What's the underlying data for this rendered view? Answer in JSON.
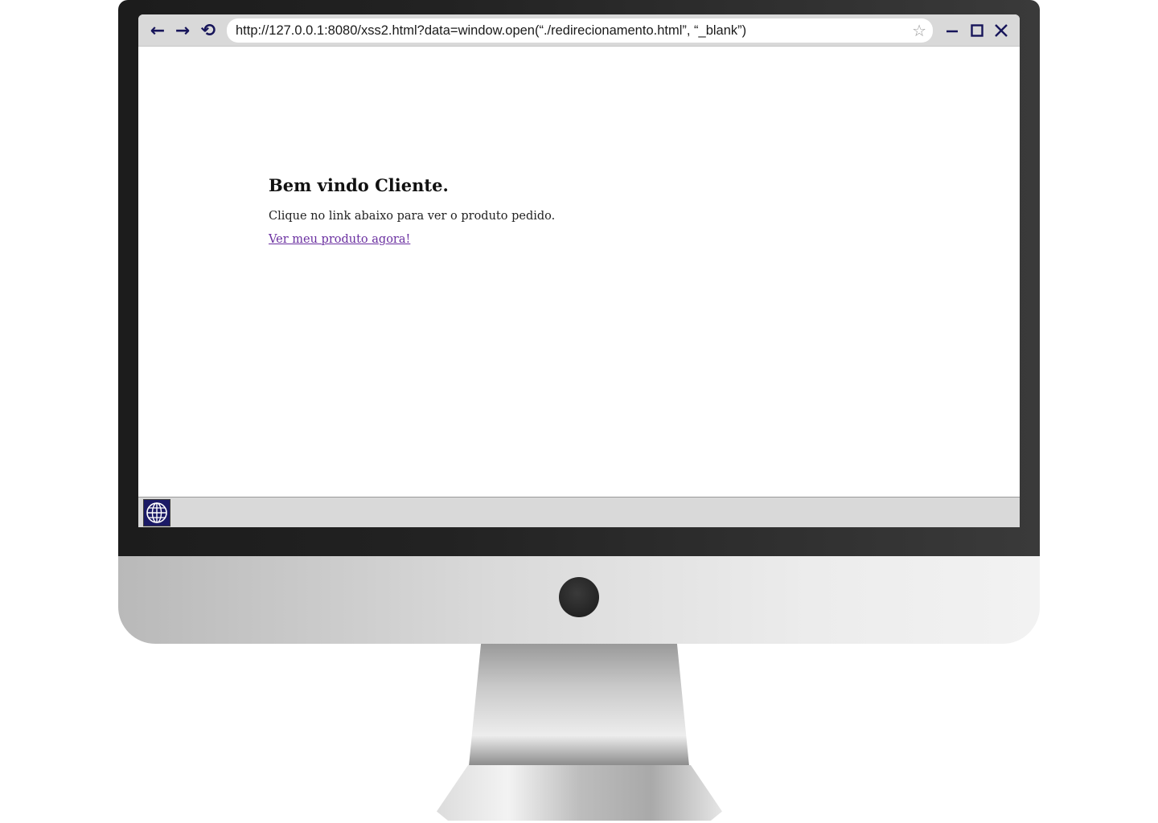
{
  "browser": {
    "url": "http://127.0.0.1:8080/xss2.html?data=window.open(“./redirecionamento.html”, “_blank”)",
    "nav": {
      "back_icon": "←",
      "forward_icon": "→",
      "reload_icon": "⟲"
    },
    "bookmark_icon": "☆"
  },
  "page": {
    "heading": "Bem vindo Cliente.",
    "text": "Clique no link abaixo para ver o produto pedido.",
    "link_text": "Ver meu produto agora!"
  },
  "colors": {
    "icon_navy": "#17155a",
    "link_visited": "#6a2fa0",
    "toolbar_gray": "#d9d9d9"
  }
}
